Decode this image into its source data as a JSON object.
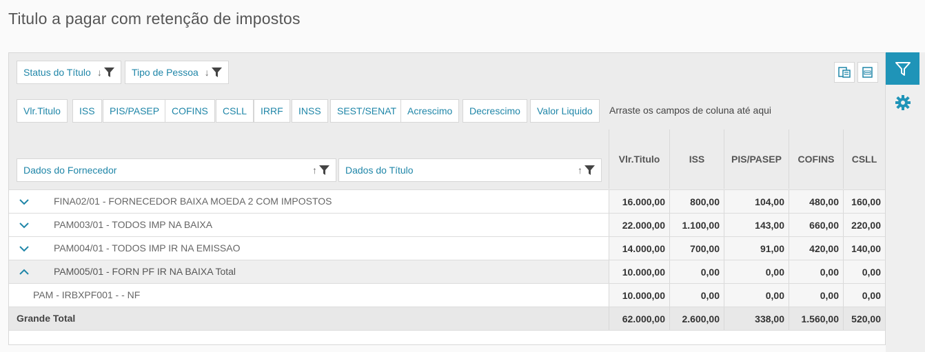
{
  "page": {
    "title": "Titulo a pagar com retenção de impostos"
  },
  "filter_fields": [
    {
      "label": "Status do Título"
    },
    {
      "label": "Tipo de Pessoa"
    }
  ],
  "column_fields": [
    "Vlr.Titulo",
    "ISS",
    "PIS/PASEP",
    "COFINS",
    "CSLL",
    "IRRF",
    "INSS",
    "SEST/SENAT",
    "Acrescimo",
    "Decrescimo",
    "Valor Liquido"
  ],
  "drop_hint": "Arraste os campos de coluna até aqui",
  "row_fields": [
    {
      "label": "Dados do Fornecedor"
    },
    {
      "label": "Dados do Título"
    }
  ],
  "value_headers": [
    "Vlr.Titulo",
    "ISS",
    "PIS/PASEP",
    "COFINS",
    "CSLL"
  ],
  "rows": [
    {
      "label": "FINA02/01 - FORNECEDOR BAIXA MOEDA 2 COM IMPOSTOS",
      "state": "collapsed",
      "values": [
        "16.000,00",
        "800,00",
        "104,00",
        "480,00",
        "160,00"
      ]
    },
    {
      "label": "PAM003/01 - TODOS IMP NA BAIXA",
      "state": "collapsed",
      "values": [
        "22.000,00",
        "1.100,00",
        "143,00",
        "660,00",
        "220,00"
      ]
    },
    {
      "label": "PAM004/01 - TODOS IMP IR NA EMISSAO",
      "state": "collapsed",
      "values": [
        "14.000,00",
        "700,00",
        "91,00",
        "420,00",
        "140,00"
      ]
    },
    {
      "label": "PAM005/01 - FORN PF IR NA BAIXA Total",
      "state": "expanded",
      "values": [
        "10.000,00",
        "0,00",
        "0,00",
        "0,00",
        "0,00"
      ]
    },
    {
      "label": "PAM - IRBXPF001 - - NF",
      "state": "child",
      "values": [
        "10.000,00",
        "0,00",
        "0,00",
        "0,00",
        "0,00"
      ]
    },
    {
      "label": "Grande Total",
      "state": "total",
      "values": [
        "62.000,00",
        "2.600,00",
        "338,00",
        "1.560,00",
        "520,00"
      ]
    }
  ],
  "icons": {
    "filter": "filter-icon",
    "sort_down": "sort-arrow-down-icon",
    "sort_up": "sort-arrow-up-icon",
    "chevron_down": "chevron-down-icon",
    "chevron_up": "chevron-up-icon",
    "gear": "gear-icon",
    "export_excel": "export-excel-icon",
    "export_csv": "export-csv-icon"
  },
  "colors": {
    "accent": "#1f94b8",
    "link": "#1f86a8"
  }
}
